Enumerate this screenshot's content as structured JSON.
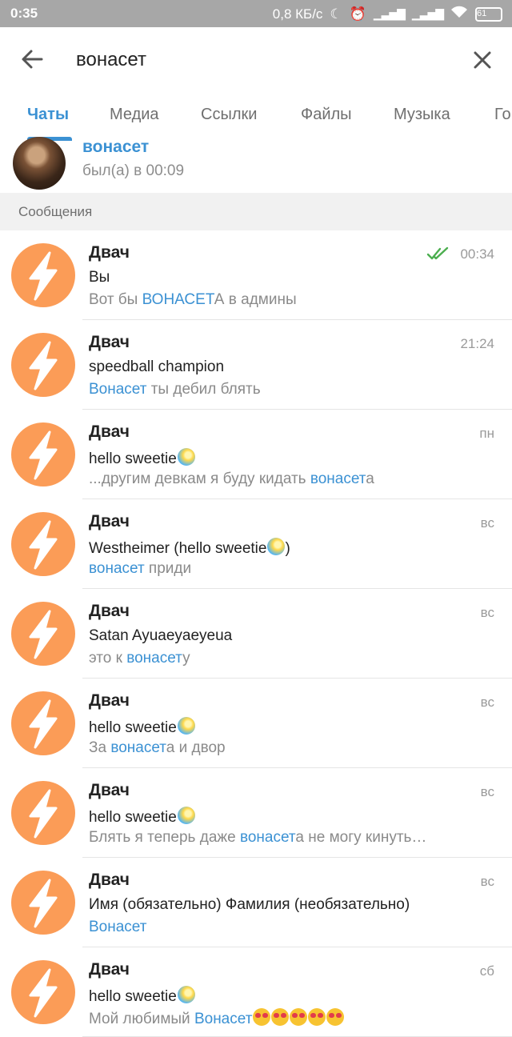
{
  "status_bar": {
    "time": "0:35",
    "network_speed": "0,8 КБ/с",
    "battery": "61"
  },
  "search": {
    "query": "вонасет",
    "back_icon": "arrow-left-icon",
    "clear_icon": "close-icon"
  },
  "tabs": [
    {
      "label": "Чаты",
      "active": true
    },
    {
      "label": "Медиа"
    },
    {
      "label": "Ссылки"
    },
    {
      "label": "Файлы"
    },
    {
      "label": "Музыка"
    },
    {
      "label": "Го"
    }
  ],
  "contact": {
    "name": "вонасет",
    "status": "был(а) в 00:09"
  },
  "section_title": "Сообщения",
  "messages": [
    {
      "chat": "Двач",
      "sender": "Вы",
      "time": "00:34",
      "read": true,
      "text_pre": "Вот бы ",
      "text_hl": "ВОНАСЕТ",
      "text_post": "А в админы"
    },
    {
      "chat": "Двач",
      "sender": "speedball champion",
      "time": "21:24",
      "text_pre": "",
      "text_hl": "Вонасет",
      "text_post": " ты дебил блять"
    },
    {
      "chat": "Двач",
      "sender": "hello sweetie",
      "time": "пн",
      "text_pre": "...другим девкам я буду кидать ",
      "text_hl": "вонасет",
      "text_post": "а"
    },
    {
      "chat": "Двач",
      "sender": "Westheimer (hello sweetie",
      "sender_suffix": ")",
      "time": "вс",
      "text_pre": "",
      "text_hl": "вонасет",
      "text_post": " приди"
    },
    {
      "chat": "Двач",
      "sender": "  Satan Ayuaeyaeyeua",
      "time": "вс",
      "text_pre": "это к ",
      "text_hl": "вонасет",
      "text_post": "у"
    },
    {
      "chat": "Двач",
      "sender": "hello sweetie",
      "time": "вс",
      "text_pre": "За ",
      "text_hl": "вонасет",
      "text_post": "а и двор"
    },
    {
      "chat": "Двач",
      "sender": "hello sweetie",
      "time": "вс",
      "text_pre": "Блять я теперь даже ",
      "text_hl": "вонасет",
      "text_post": "а не могу кинуть…"
    },
    {
      "chat": "Двач",
      "sender": "Имя (обязательно) Фамилия (необязательно)",
      "time": "вс",
      "text_pre": "",
      "text_hl": "Вонасет",
      "text_post": ""
    },
    {
      "chat": "Двач",
      "sender": "hello sweetie",
      "time": "сб",
      "text_pre": "Мой любимый ",
      "text_hl": "Вонасет",
      "text_post": ""
    }
  ],
  "colors": {
    "accent": "#3b91d3",
    "avatar": "#fb9c57",
    "status_bar": "#a7a7a7"
  }
}
